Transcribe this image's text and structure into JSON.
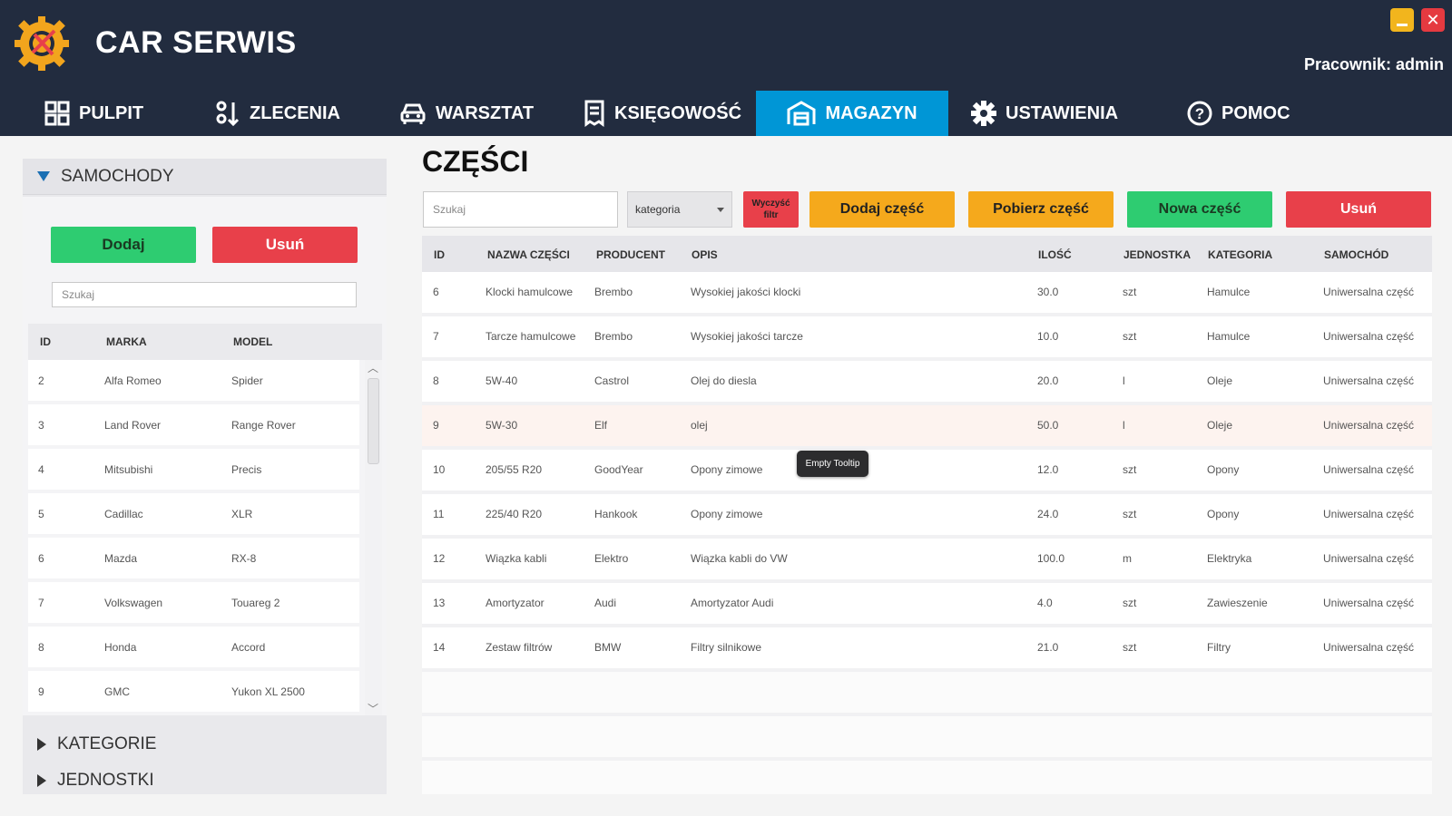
{
  "app": {
    "title": "CAR SERWIS",
    "user_label": "Pracownik: admin",
    "colors": {
      "header_bg": "#222c3f",
      "active_tab": "#0096d6",
      "green": "#2ecc71",
      "red": "#e8404a",
      "orange": "#f5a91c"
    }
  },
  "nav": {
    "items": [
      {
        "label": "PULPIT",
        "icon": "dashboard-icon"
      },
      {
        "label": "ZLECENIA",
        "icon": "sort-icon"
      },
      {
        "label": "WARSZTAT",
        "icon": "car-icon"
      },
      {
        "label": "KSIĘGOWOŚĆ",
        "icon": "receipt-icon"
      },
      {
        "label": "MAGAZYN",
        "icon": "warehouse-icon",
        "active": true
      },
      {
        "label": "USTAWIENIA",
        "icon": "gear-icon"
      },
      {
        "label": "POMOC",
        "icon": "help-icon"
      }
    ]
  },
  "sidebar": {
    "samochody_label": "SAMOCHODY",
    "add_label": "Dodaj",
    "delete_label": "Usuń",
    "search_placeholder": "Szukaj",
    "columns": [
      "ID",
      "MARKA",
      "MODEL"
    ],
    "rows": [
      {
        "id": "2",
        "marka": "Alfa Romeo",
        "model": "Spider"
      },
      {
        "id": "3",
        "marka": "Land Rover",
        "model": "Range Rover"
      },
      {
        "id": "4",
        "marka": "Mitsubishi",
        "model": "Precis"
      },
      {
        "id": "5",
        "marka": "Cadillac",
        "model": "XLR"
      },
      {
        "id": "6",
        "marka": "Mazda",
        "model": "RX-8"
      },
      {
        "id": "7",
        "marka": "Volkswagen",
        "model": "Touareg 2"
      },
      {
        "id": "8",
        "marka": "Honda",
        "model": "Accord"
      },
      {
        "id": "9",
        "marka": "GMC",
        "model": "Yukon XL 2500"
      }
    ],
    "kategorie_label": "KATEGORIE",
    "jednostki_label": "JEDNOSTKI"
  },
  "main": {
    "title": "CZĘŚCI",
    "search_placeholder": "Szukaj",
    "category_select": "kategoria",
    "clear_filter_label_1": "Wyczyść",
    "clear_filter_label_2": "filtr",
    "add_part_label": "Dodaj część",
    "get_part_label": "Pobierz część",
    "new_part_label": "Nowa część",
    "delete_label": "Usuń",
    "columns": [
      "ID",
      "NAZWA CZĘŚCI",
      "PRODUCENT",
      "OPIS",
      "ILOŚĆ",
      "JEDNOSTKA",
      "KATEGORIA",
      "SAMOCHÓD"
    ],
    "rows": [
      {
        "id": "6",
        "nazwa": "Klocki hamulcowe",
        "producent": "Brembo",
        "opis": "Wysokiej jakości klocki",
        "ilosc": "30.0",
        "jednostka": "szt",
        "kategoria": "Hamulce",
        "samochod": "Uniwersalna część"
      },
      {
        "id": "7",
        "nazwa": "Tarcze hamulcowe",
        "producent": "Brembo",
        "opis": "Wysokiej jakości tarcze",
        "ilosc": "10.0",
        "jednostka": "szt",
        "kategoria": "Hamulce",
        "samochod": "Uniwersalna część"
      },
      {
        "id": "8",
        "nazwa": "5W-40",
        "producent": "Castrol",
        "opis": "Olej do diesla",
        "ilosc": "20.0",
        "jednostka": "l",
        "kategoria": "Oleje",
        "samochod": "Uniwersalna część"
      },
      {
        "id": "9",
        "nazwa": "5W-30",
        "producent": "Elf",
        "opis": "olej",
        "ilosc": "50.0",
        "jednostka": "l",
        "kategoria": "Oleje",
        "samochod": "Uniwersalna część"
      },
      {
        "id": "10",
        "nazwa": "205/55 R20",
        "producent": "GoodYear",
        "opis": "Opony zimowe",
        "ilosc": "12.0",
        "jednostka": "szt",
        "kategoria": "Opony",
        "samochod": "Uniwersalna część"
      },
      {
        "id": "11",
        "nazwa": "225/40 R20",
        "producent": "Hankook",
        "opis": "Opony zimowe",
        "ilosc": "24.0",
        "jednostka": "szt",
        "kategoria": "Opony",
        "samochod": "Uniwersalna część"
      },
      {
        "id": "12",
        "nazwa": "Wiązka kabli",
        "producent": "Elektro",
        "opis": "Wiązka kabli do VW",
        "ilosc": "100.0",
        "jednostka": "m",
        "kategoria": "Elektryka",
        "samochod": "Uniwersalna część"
      },
      {
        "id": "13",
        "nazwa": "Amortyzator",
        "producent": " Audi",
        "opis": "Amortyzator Audi",
        "ilosc": "4.0",
        "jednostka": "szt",
        "kategoria": "Zawieszenie",
        "samochod": "Uniwersalna część"
      },
      {
        "id": "14",
        "nazwa": "Zestaw filtrów",
        "producent": "BMW",
        "opis": "Filtry silnikowe",
        "ilosc": "21.0",
        "jednostka": "szt",
        "kategoria": "Filtry",
        "samochod": "Uniwersalna część"
      }
    ],
    "tooltip": "Empty Tooltip"
  }
}
